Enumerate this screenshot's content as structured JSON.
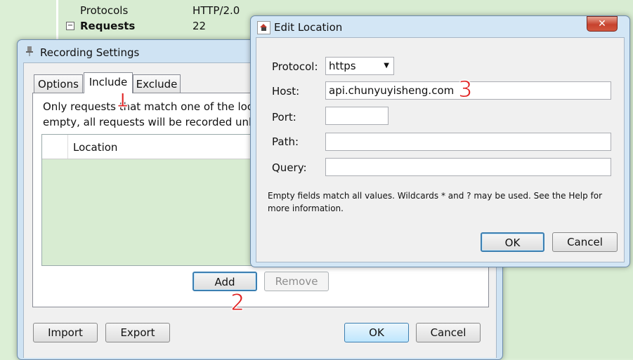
{
  "background_tree": {
    "rows": [
      {
        "key": "Protocols",
        "value": "HTTP/2.0",
        "bold": false
      },
      {
        "key": "Requests",
        "value": "22",
        "bold": true,
        "toggle": "−"
      }
    ]
  },
  "recording_settings": {
    "title": "Recording Settings",
    "icon": "pin-icon",
    "tabs": [
      {
        "label": "Options",
        "active": false
      },
      {
        "label": "Include",
        "active": true
      },
      {
        "label": "Exclude",
        "active": false
      }
    ],
    "description_line1": "Only requests that match one of the loca",
    "description_line2": "empty, all requests will be recorded unle",
    "table": {
      "column_location": "Location"
    },
    "buttons": {
      "add": "Add",
      "remove": "Remove",
      "import": "Import",
      "export": "Export",
      "ok": "OK",
      "cancel": "Cancel"
    }
  },
  "edit_location": {
    "title": "Edit Location",
    "icon": "app-icon",
    "close_label": "✕",
    "protocol_label": "Protocol:",
    "protocol_value": "https",
    "host_label": "Host:",
    "host_value": "api.chunyuyisheng.com",
    "port_label": "Port:",
    "port_value": "",
    "path_label": "Path:",
    "path_value": "",
    "query_label": "Query:",
    "query_value": "",
    "hint_line1": "Empty fields match all values. Wildcards * and ? may be used. See the Help for",
    "hint_line2": "more information.",
    "ok": "OK",
    "cancel": "Cancel"
  },
  "annotations": [
    "1",
    "2",
    "3"
  ],
  "colors": {
    "annotation": "#e02020",
    "focus": "#3c7fb1",
    "table_bg": "#d8ecd2"
  }
}
